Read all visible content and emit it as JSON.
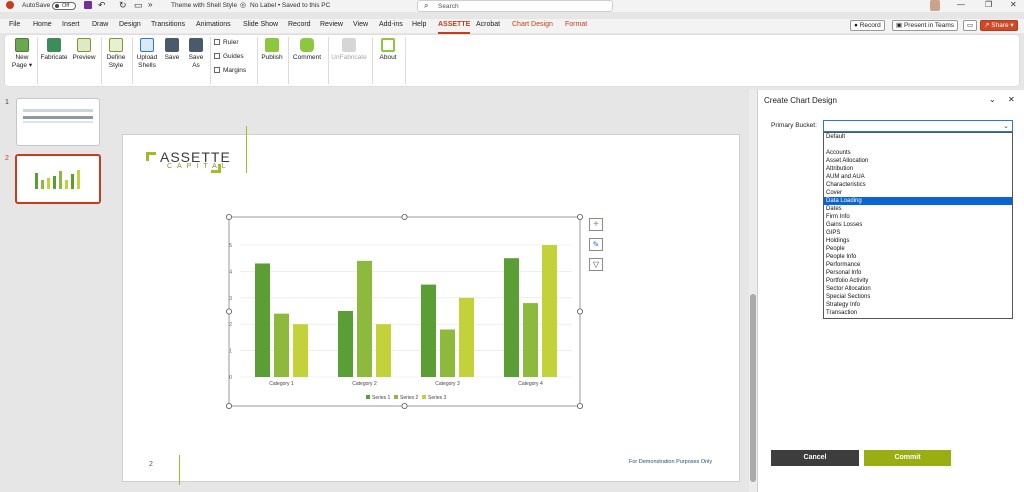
{
  "titlebar": {
    "autosave": "AutoSave",
    "autosave_state": "Off",
    "doc_title": "Theme with Shell Style",
    "label": "No Label • Saved to this PC",
    "search": "Search"
  },
  "menu": [
    "File",
    "Home",
    "Insert",
    "Draw",
    "Design",
    "Transitions",
    "Animations",
    "Slide Show",
    "Record",
    "Review",
    "View",
    "Add-ins",
    "Help",
    "ASSETTE",
    "Acrobat",
    "Chart Design",
    "Format"
  ],
  "header_buttons": {
    "record": "Record",
    "teams": "Present in Teams",
    "share": "Share"
  },
  "ribbon": {
    "new_page": "New Page",
    "fabricate": "Fabricate",
    "preview": "Preview",
    "define_style": "Define Style",
    "upload_shells": "Upload Shells",
    "save": "Save",
    "save_as": "Save As",
    "ruler": "Ruler",
    "guides": "Guides",
    "margins": "Margins",
    "publish": "Publish",
    "comment": "Comment",
    "unfabricate": "UnFabricate",
    "about": "About"
  },
  "slides": {
    "thumb1": "1",
    "thumb2": "2"
  },
  "slide": {
    "logo": "ASSETTE",
    "logo_sub": "CAPITAL",
    "page_number": "2",
    "footer_note": "For Demonstration Purposes Only"
  },
  "chart_data": {
    "type": "bar",
    "categories": [
      "Category 1",
      "Category 2",
      "Category 3",
      "Category 4"
    ],
    "series": [
      {
        "name": "Series 1",
        "values": [
          4.3,
          2.5,
          3.5,
          4.5
        ],
        "color": "#5a9e35"
      },
      {
        "name": "Series 2",
        "values": [
          2.4,
          4.4,
          1.8,
          2.8
        ],
        "color": "#8dba3c"
      },
      {
        "name": "Series 3",
        "values": [
          2.0,
          2.0,
          3.0,
          5.0
        ],
        "color": "#c3d23b"
      }
    ],
    "yticks": [
      "0",
      "1",
      "2",
      "3",
      "4",
      "5"
    ],
    "ylim": [
      0,
      5
    ],
    "legend": "bottom",
    "grid": true
  },
  "pane": {
    "title": "Create Chart Design",
    "primary_bucket_label": "Primary Bucket:",
    "options": [
      "Default",
      "",
      "Accounts",
      "Asset Allocation",
      "Attribution",
      "AUM and AUA",
      "Characteristics",
      "Cover",
      "Data Loading",
      "Dates",
      "Firm Info",
      "Gains Losses",
      "GIPS",
      "Holdings",
      "People",
      "People Info",
      "Performance",
      "Personal Info",
      "Portfolio Activity",
      "Sector Allocation",
      "Special Sections",
      "Strategy Info",
      "Transaction"
    ],
    "highlighted": "Data Loading",
    "cancel": "Cancel",
    "commit": "Commit"
  },
  "colors": {
    "accent": "#c43e1c",
    "brand_green": "#a6b92c",
    "commit": "#9aad12",
    "cancel": "#3d3d3d",
    "highlight": "#0a64d2"
  }
}
